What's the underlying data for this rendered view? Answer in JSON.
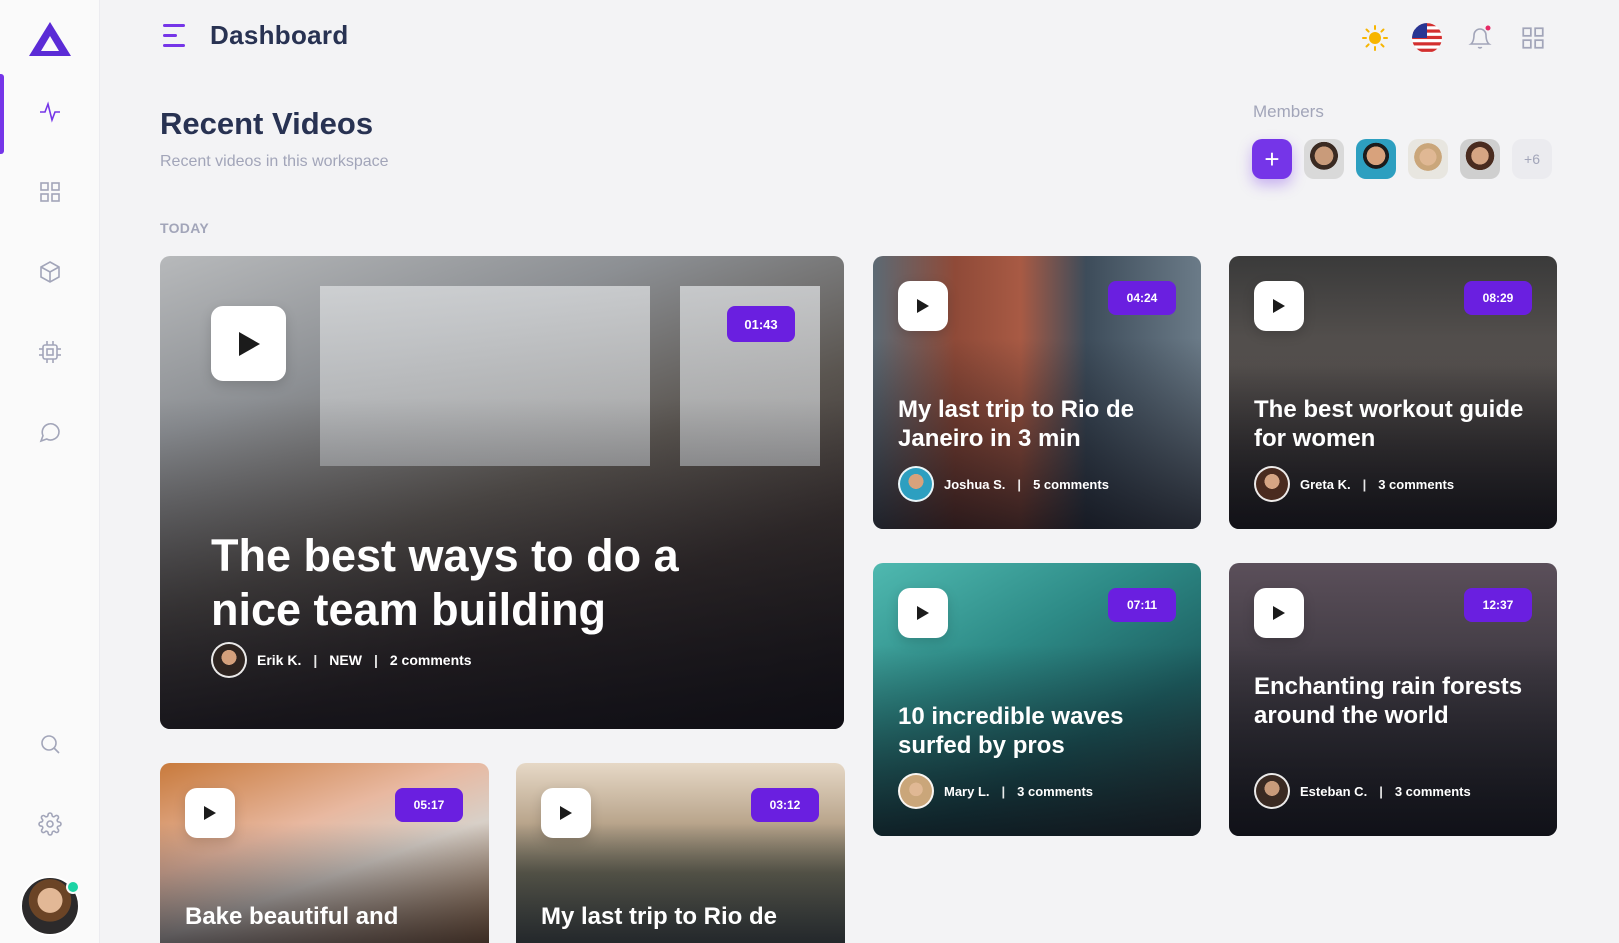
{
  "header": {
    "title": "Dashboard"
  },
  "sidebar": {
    "items": [
      {
        "name": "activity-icon",
        "active": true
      },
      {
        "name": "grid-icon",
        "active": false
      },
      {
        "name": "box-icon",
        "active": false
      },
      {
        "name": "cpu-icon",
        "active": false
      },
      {
        "name": "message-icon",
        "active": false
      },
      {
        "name": "search-icon",
        "active": false
      },
      {
        "name": "gear-icon",
        "active": false
      }
    ]
  },
  "section": {
    "title": "Recent Videos",
    "subtitle": "Recent videos in this workspace",
    "group_label": "TODAY"
  },
  "members": {
    "label": "Members",
    "add_label": "+",
    "more_label": "+6"
  },
  "videos": [
    {
      "title": "The best ways to do a nice team building",
      "duration": "01:43",
      "author": "Erik K.",
      "tag": "NEW",
      "comments": "2 comments"
    },
    {
      "title": "My last trip to Rio de Janeiro in 3 min",
      "duration": "04:24",
      "author": "Joshua S.",
      "comments": "5 comments"
    },
    {
      "title": "The best workout guide for women",
      "duration": "08:29",
      "author": "Greta K.",
      "comments": "3 comments"
    },
    {
      "title": "10 incredible waves surfed by pros",
      "duration": "07:11",
      "author": "Mary L.",
      "comments": "3 comments"
    },
    {
      "title": "Enchanting rain forests around the world",
      "duration": "12:37",
      "author": "Esteban C.",
      "comments": "3 comments"
    },
    {
      "title": "Bake beautiful and",
      "duration": "05:17"
    },
    {
      "title": "My last trip to Rio de",
      "duration": "03:12"
    }
  ],
  "colors": {
    "accent": "#7535e8",
    "badge": "#6a1fe0",
    "online": "#1bd3a4"
  }
}
